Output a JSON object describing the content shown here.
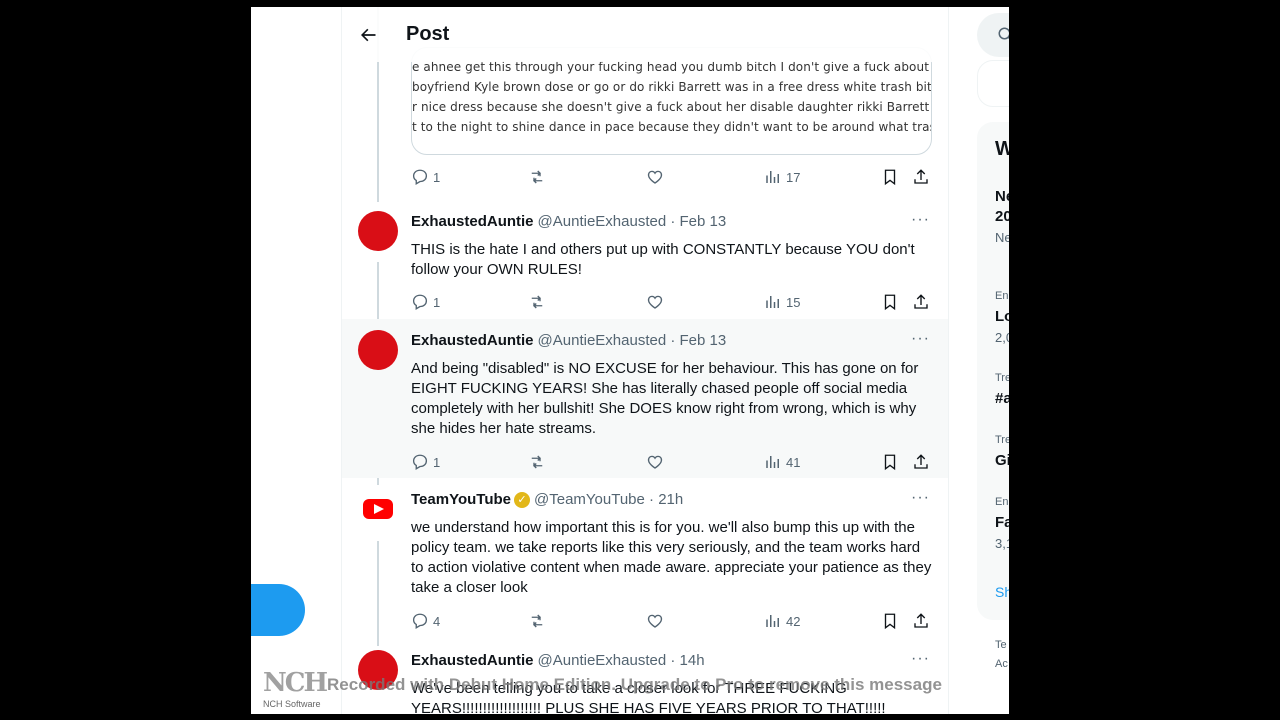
{
  "header": {
    "title": "Post"
  },
  "quote": {
    "lines": [
      "e ahnee  get this through your fucking head you dumb bitch  I don't give a fuck about wi",
      " boyfriend Kyle brown dose or go  or do  rikki Barrett was in a free dress  white trash bitc",
      "r nice dress because she doesn't give a fuck about her disable daughter rikki Barrett an",
      "t to the night to shine dance in pace because they didn't want to be around what trash b"
    ]
  },
  "first_actions": {
    "replies": "1",
    "views": "17"
  },
  "tweets": [
    {
      "name": "ExhaustedAuntie",
      "handle": "@AuntieExhausted · Feb 13",
      "text": "THIS is the hate I and others put up with CONSTANTLY because YOU don't follow your OWN RULES!",
      "replies": "1",
      "views": "15"
    },
    {
      "name": "ExhaustedAuntie",
      "handle": "@AuntieExhausted · Feb 13",
      "text": "And being \"disabled\" is NO EXCUSE for her behaviour.  This has gone on for EIGHT FUCKING YEARS!  She has literally chased people off social media completely with her bullshit!  She DOES know right from wrong, which is why she hides her hate streams.",
      "replies": "1",
      "views": "41"
    },
    {
      "name": "TeamYouTube",
      "handle": "@TeamYouTube · 21h",
      "text": "we understand how important this is for you. we'll also bump this up with the policy team. we take reports like this very seriously, and the team works hard to action violative content when made aware. appreciate your patience as they take a closer look",
      "replies": "4",
      "views": "42"
    },
    {
      "name": "ExhaustedAuntie",
      "handle": "@AuntieExhausted · 14h",
      "text": "We've been telling you to take a closer look for THREE FUCKING YEARS!!!!!!!!!!!!!!!!!!!  PLUS SHE HAS FIVE YEARS PRIOR TO THAT!!!!!",
      "replies": "",
      "views": ""
    }
  ],
  "right_sidebar": {
    "header_fragment": "W",
    "items": [
      {
        "a": "Ne",
        "b": "20",
        "c": "Ne"
      },
      {
        "a": "En",
        "b": "Lo",
        "c": "2,0"
      },
      {
        "a": "Tre",
        "b": "#a"
      },
      {
        "a": "Tre",
        "b": "Gi"
      },
      {
        "a": "En",
        "b": "Fa",
        "c": "3,1"
      },
      {
        "a": "Sh"
      },
      {
        "a": "Te",
        "b": "Ac"
      }
    ]
  },
  "watermark": {
    "logo": "NCH",
    "sub": "NCH Software",
    "text": "Recorded with Debut Home Edition. Upgrade to Pro to remove this message"
  },
  "icons": [
    "back-arrow-icon",
    "reply-icon",
    "retweet-icon",
    "like-icon",
    "views-icon",
    "bookmark-icon",
    "share-icon",
    "verified-badge-icon",
    "search-icon"
  ],
  "colors": {
    "avatar": "#d90e16",
    "accent": "#1d9bf0",
    "verified": "#e2b719",
    "youtube": "#ff0000"
  }
}
